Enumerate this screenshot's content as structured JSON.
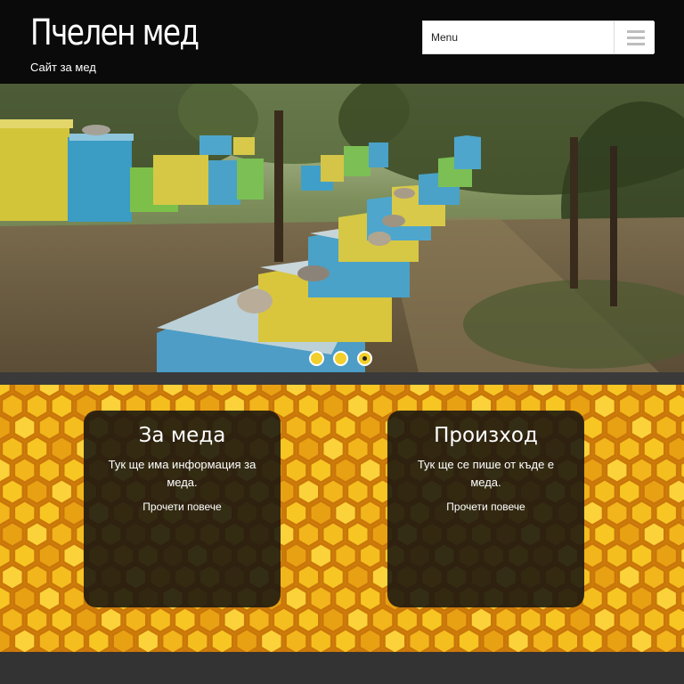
{
  "header": {
    "title": "Пчелен мед",
    "tagline": "Сайт за мед",
    "menu_label": "Menu",
    "menu_icon": "hamburger-icon"
  },
  "slider": {
    "image": "beehives-in-orchard",
    "slide_count": 3,
    "active_slide": 3
  },
  "cards": [
    {
      "title": "За меда",
      "text": "Тук ще има информация за меда.",
      "link": "Прочети повече"
    },
    {
      "title": "Произход",
      "text": "Тук ще се пише от къде е меда.",
      "link": "Прочети повече"
    }
  ],
  "colors": {
    "header_bg": "#0a0a0a",
    "dot": "#f2cf2a",
    "honey": "#f0b31c",
    "card_bg": "#181610",
    "footer_bg": "#333333"
  }
}
